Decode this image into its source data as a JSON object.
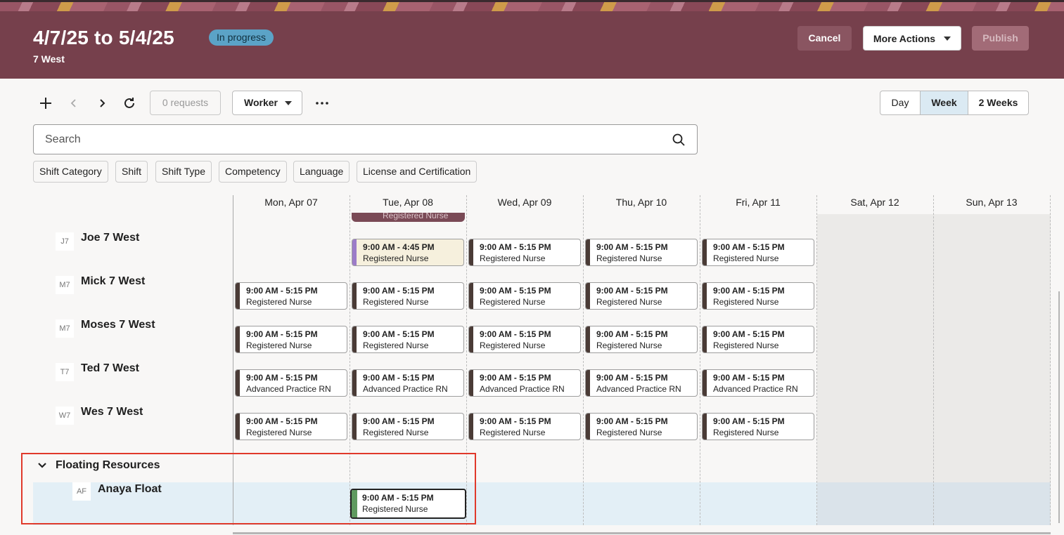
{
  "header": {
    "title": "4/7/25 to 5/4/25",
    "status": "In progress",
    "subtitle": "7 West",
    "cancel_label": "Cancel",
    "more_actions_label": "More Actions",
    "publish_label": "Publish",
    "accent_color": "#76404c",
    "status_color": "#5ba3c7"
  },
  "toolbar": {
    "add_icon": "plus-icon",
    "prev_icon": "chevron-left-icon",
    "next_icon": "chevron-right-icon",
    "refresh_icon": "refresh-icon",
    "requests_label": "0 requests",
    "view_by_label": "Worker",
    "overflow_icon": "more-horizontal-icon",
    "views": [
      "Day",
      "Week",
      "2 Weeks"
    ],
    "selected_view": "Week"
  },
  "search": {
    "placeholder": "Search"
  },
  "filters": [
    "Shift Category",
    "Shift",
    "Shift Type",
    "Competency",
    "Language",
    "License and Certification"
  ],
  "days": [
    "Mon, Apr 07",
    "Tue, Apr 08",
    "Wed, Apr 09",
    "Thu, Apr 10",
    "Fri, Apr 11",
    "Sat, Apr 12",
    "Sun, Apr 13"
  ],
  "cutoff_shift_role": "Registered Nurse",
  "workers": [
    {
      "initials": "J7",
      "name": "Joe 7 West",
      "shifts": [
        null,
        {
          "time": "9:00 AM - 4:45 PM",
          "role": "Registered Nurse",
          "style": "purple"
        },
        {
          "time": "9:00 AM - 5:15 PM",
          "role": "Registered Nurse"
        },
        {
          "time": "9:00 AM - 5:15 PM",
          "role": "Registered Nurse"
        },
        {
          "time": "9:00 AM - 5:15 PM",
          "role": "Registered Nurse"
        }
      ]
    },
    {
      "initials": "M7",
      "name": "Mick 7 West",
      "shifts": [
        {
          "time": "9:00 AM - 5:15 PM",
          "role": "Registered Nurse"
        },
        {
          "time": "9:00 AM - 5:15 PM",
          "role": "Registered Nurse"
        },
        {
          "time": "9:00 AM - 5:15 PM",
          "role": "Registered Nurse"
        },
        {
          "time": "9:00 AM - 5:15 PM",
          "role": "Registered Nurse"
        },
        {
          "time": "9:00 AM - 5:15 PM",
          "role": "Registered Nurse"
        }
      ]
    },
    {
      "initials": "M7",
      "name": "Moses 7 West",
      "shifts": [
        {
          "time": "9:00 AM - 5:15 PM",
          "role": "Registered Nurse"
        },
        {
          "time": "9:00 AM - 5:15 PM",
          "role": "Registered Nurse"
        },
        {
          "time": "9:00 AM - 5:15 PM",
          "role": "Registered Nurse"
        },
        {
          "time": "9:00 AM - 5:15 PM",
          "role": "Registered Nurse"
        },
        {
          "time": "9:00 AM - 5:15 PM",
          "role": "Registered Nurse"
        }
      ]
    },
    {
      "initials": "T7",
      "name": "Ted 7 West",
      "shifts": [
        {
          "time": "9:00 AM - 5:15 PM",
          "role": "Advanced Practice RN"
        },
        {
          "time": "9:00 AM - 5:15 PM",
          "role": "Advanced Practice RN"
        },
        {
          "time": "9:00 AM - 5:15 PM",
          "role": "Advanced Practice RN"
        },
        {
          "time": "9:00 AM - 5:15 PM",
          "role": "Advanced Practice RN"
        },
        {
          "time": "9:00 AM - 5:15 PM",
          "role": "Advanced Practice RN"
        }
      ]
    },
    {
      "initials": "W7",
      "name": "Wes 7 West",
      "shifts": [
        {
          "time": "9:00 AM - 5:15 PM",
          "role": "Registered Nurse"
        },
        {
          "time": "9:00 AM - 5:15 PM",
          "role": "Registered Nurse"
        },
        {
          "time": "9:00 AM - 5:15 PM",
          "role": "Registered Nurse"
        },
        {
          "time": "9:00 AM - 5:15 PM",
          "role": "Registered Nurse"
        },
        {
          "time": "9:00 AM - 5:15 PM",
          "role": "Registered Nurse"
        }
      ]
    }
  ],
  "floating_group": {
    "label": "Floating Resources",
    "expanded_icon": "chevron-down-icon",
    "worker": {
      "initials": "AF",
      "name": "Anaya Float",
      "shift": {
        "day_index": 1,
        "time": "9:00 AM - 5:15 PM",
        "role": "Registered Nurse",
        "style": "selected"
      }
    }
  }
}
